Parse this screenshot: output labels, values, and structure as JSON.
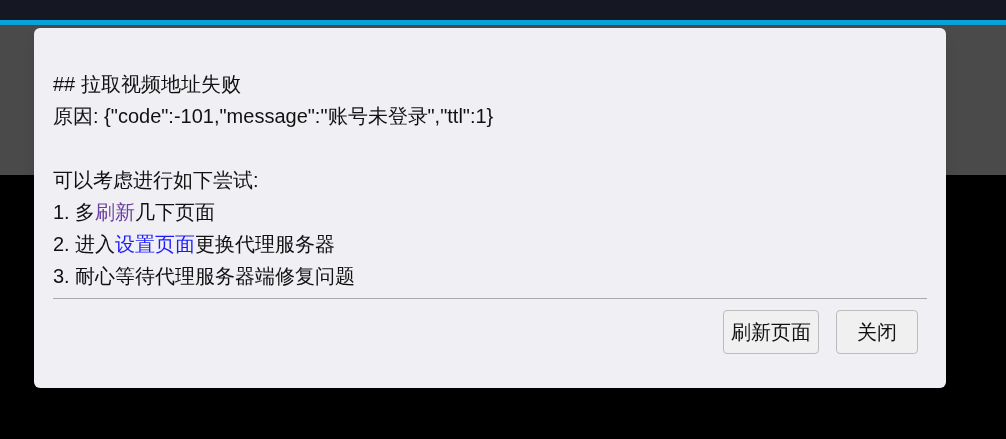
{
  "dialog": {
    "heading": "## 拉取视频地址失败",
    "reason": "原因: {\"code\":-101,\"message\":\"账号未登录\",\"ttl\":1}",
    "intro": "可以考虑进行如下尝试:",
    "steps": [
      [
        {
          "kind": "plain",
          "text": "1. 多"
        },
        {
          "kind": "link",
          "text": "刷新",
          "visited": true
        },
        {
          "kind": "plain",
          "text": "几下页面"
        }
      ],
      [
        {
          "kind": "plain",
          "text": "2. 进入"
        },
        {
          "kind": "link",
          "text": "设置页面",
          "visited": false
        },
        {
          "kind": "plain",
          "text": "更换代理服务器"
        }
      ],
      [
        {
          "kind": "plain",
          "text": "3. 耐心等待代理服务器端修复问题"
        }
      ]
    ],
    "buttons": [
      "刷新页面",
      "关闭"
    ]
  }
}
